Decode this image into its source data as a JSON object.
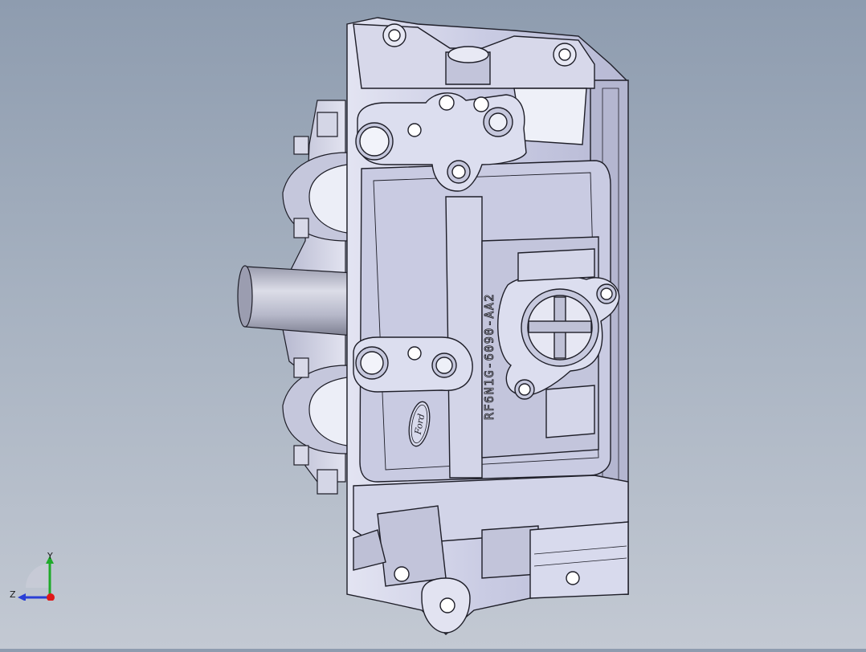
{
  "viewport": {
    "model_engraving": "RF6N1G-6090-AA2",
    "logo_text": "Ford",
    "background_top": "#8e9caf",
    "background_bottom": "#c3c9d3",
    "part_face_color": "#cfd1e8",
    "part_edge_color": "#1e1e28"
  },
  "triad": {
    "y_label": "Y",
    "z_label": "Z",
    "y_color": "#1faa2a",
    "z_color": "#2a3fd6",
    "x_color": "#e01818"
  }
}
